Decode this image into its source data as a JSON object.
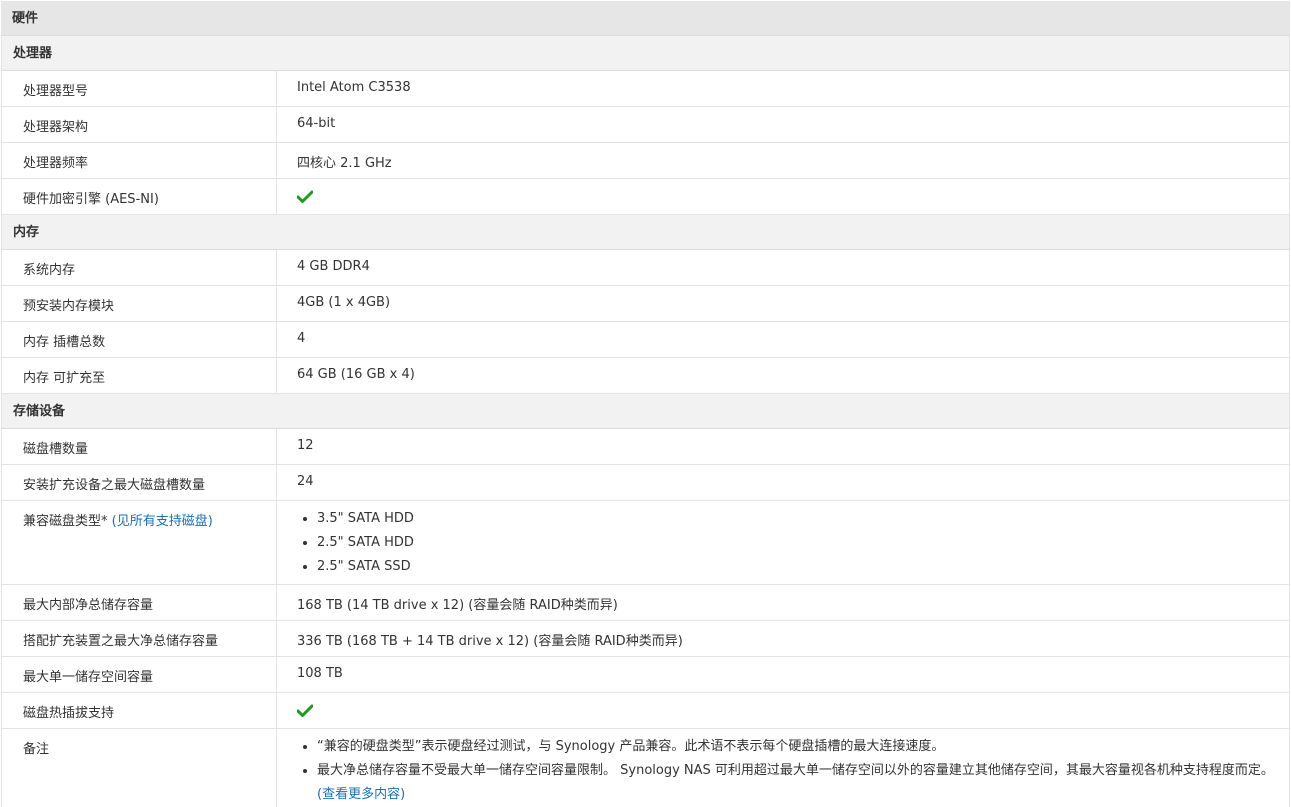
{
  "header": {
    "title": "硬件"
  },
  "sections": {
    "cpu": {
      "title": "处理器",
      "rows": [
        {
          "label": "处理器型号",
          "value": "Intel Atom C3538"
        },
        {
          "label": "处理器架构",
          "value": "64-bit"
        },
        {
          "label": "处理器频率",
          "value": "四核心 2.1 GHz"
        },
        {
          "label": "硬件加密引擎 (AES-NI)",
          "value": ""
        }
      ]
    },
    "memory": {
      "title": "内存",
      "rows": [
        {
          "label": "系统内存",
          "value": "4 GB DDR4"
        },
        {
          "label": "预安装内存模块",
          "value": "4GB (1 x 4GB)"
        },
        {
          "label": "内存 插槽总数",
          "value": "4"
        },
        {
          "label": "内存 可扩充至",
          "value": "64 GB (16 GB x 4)"
        }
      ]
    },
    "storage": {
      "title": "存储设备",
      "rows": [
        {
          "label": "磁盘槽数量",
          "value": "12"
        },
        {
          "label": "安装扩充设备之最大磁盘槽数量",
          "value": "24"
        },
        {
          "label": "兼容磁盘类型*",
          "link": "(见所有支持磁盘)",
          "items": [
            "3.5\" SATA HDD",
            "2.5\" SATA HDD",
            "2.5\" SATA SSD"
          ]
        },
        {
          "label": "最大内部净总储存容量",
          "value": "168 TB (14 TB drive x 12) (容量会随 RAID种类而异)"
        },
        {
          "label": "搭配扩充装置之最大净总储存容量",
          "value": "336 TB (168 TB + 14 TB drive x 12) (容量会随 RAID种类而异)"
        },
        {
          "label": "最大单一储存空间容量",
          "value": "108 TB"
        },
        {
          "label": "磁盘热插拔支持",
          "value": ""
        },
        {
          "label": "备注",
          "notes": [
            "“兼容的硬盘类型”表示硬盘经过测试，与 Synology 产品兼容。此术语不表示每个硬盘插槽的最大连接速度。",
            "最大净总储存容量不受最大单一储存空间容量限制。 Synology NAS 可利用超过最大单一储存空间以外的容量建立其他储存空间，其最大容量视各机种支持程度而定。"
          ],
          "link": "(查看更多内容)"
        }
      ]
    }
  },
  "icons": {
    "check": "check-icon"
  },
  "colors": {
    "check": "#1e9a1e",
    "link": "#1a6fb5"
  }
}
